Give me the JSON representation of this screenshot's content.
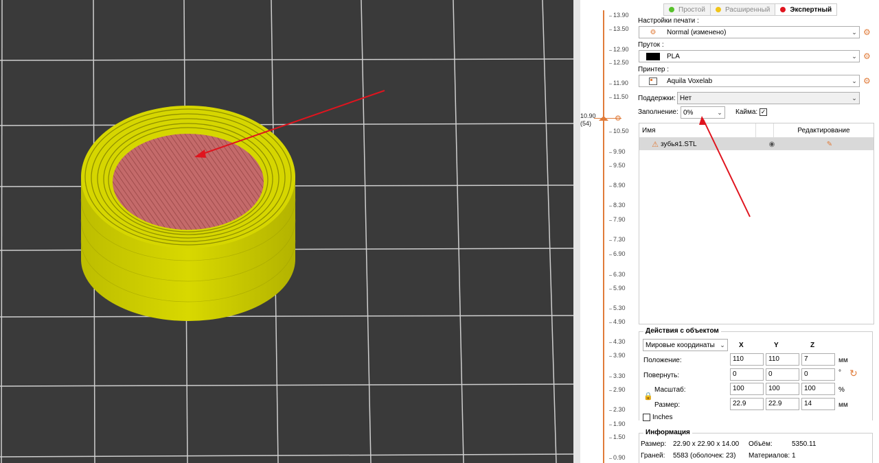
{
  "slider": {
    "labels": [
      "13.90",
      "13.50",
      "12.90",
      "12.50",
      "11.90",
      "11.50",
      "10.50",
      "9.90",
      "9.50",
      "8.90",
      "8.30",
      "7.90",
      "7.30",
      "6.90",
      "6.30",
      "5.90",
      "5.30",
      "4.90",
      "4.30",
      "3.90",
      "3.30",
      "2.90",
      "2.30",
      "1.90",
      "1.50",
      "0.90"
    ],
    "current_value": "10.90",
    "current_layer": "(54)"
  },
  "modes": [
    {
      "label": "Простой",
      "color": "#57c12b"
    },
    {
      "label": "Расширенный",
      "color": "#f0c419"
    },
    {
      "label": "Экспертный",
      "color": "#e0141e"
    }
  ],
  "print_settings": {
    "label": "Настройки печати :",
    "value": "Normal (изменено)"
  },
  "filament": {
    "label": "Пруток :",
    "value": "PLA",
    "swatch": "#000000"
  },
  "printer": {
    "label": "Принтер :",
    "value": "Aquila Voxelab"
  },
  "supports": {
    "label": "Поддержки:",
    "value": "Нет"
  },
  "infill": {
    "label": "Заполнение:",
    "value": "0%"
  },
  "brim": {
    "label": "Кайма:",
    "checked": true
  },
  "object_list": {
    "headers": {
      "name": "Имя",
      "edit": "Редактирование"
    },
    "rows": [
      {
        "name": "зубья1.STL"
      }
    ]
  },
  "manipulation": {
    "title": "Действия с объектом",
    "coord_system": "Мировые координаты",
    "axes": [
      "X",
      "Y",
      "Z"
    ],
    "rows": [
      {
        "label": "Положение:",
        "values": [
          "110",
          "110",
          "7"
        ],
        "unit": "мм"
      },
      {
        "label": "Повернуть:",
        "values": [
          "0",
          "0",
          "0"
        ],
        "unit": "°"
      },
      {
        "label": "Масштаб:",
        "values": [
          "100",
          "100",
          "100"
        ],
        "unit": "%"
      },
      {
        "label": "Размер:",
        "values": [
          "22.9",
          "22.9",
          "14"
        ],
        "unit": "мм"
      }
    ],
    "inches_label": "Inches"
  },
  "info": {
    "title": "Информация",
    "size_label": "Размер:",
    "size_value": "22.90 x 22.90 x 14.00",
    "volume_label": "Объём:",
    "volume_value": "5350.11",
    "facets_label": "Граней:",
    "facets_value": "5583 (оболочек: 23)",
    "materials_label": "Материалов:",
    "materials_value": "1"
  },
  "colors": {
    "accent": "#e07b39",
    "perimeter": "#d6d600",
    "infill": "#c46a6a",
    "bed": "#3a3a3a",
    "annotation_arrow": "#e0141e"
  }
}
